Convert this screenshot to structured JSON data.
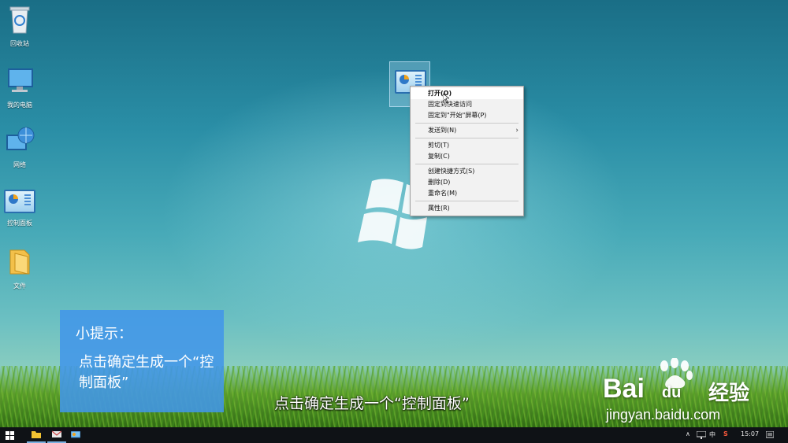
{
  "desktop": {
    "icons": [
      {
        "label": "回收站",
        "icon": "recycle-bin-icon"
      },
      {
        "label": "我的电脑",
        "icon": "computer-icon"
      },
      {
        "label": "网络",
        "icon": "network-icon"
      },
      {
        "label": "控制面板",
        "icon": "control-panel-icon"
      },
      {
        "label": "文件",
        "icon": "folder-icon"
      }
    ]
  },
  "context_menu": {
    "items": [
      {
        "label": "打开(O)",
        "highlight": true
      },
      {
        "label": "固定到快速访问"
      },
      {
        "label": "固定到\"开始\"屏幕(P)"
      },
      {
        "label": "发送到(N)",
        "submenu": true
      },
      {
        "label": "剪切(T)"
      },
      {
        "label": "复制(C)"
      },
      {
        "label": "创建快捷方式(S)"
      },
      {
        "label": "删除(D)"
      },
      {
        "label": "重命名(M)"
      },
      {
        "label": "属性(R)"
      }
    ],
    "submenu_arrow": "›"
  },
  "tip": {
    "title": "小提示：",
    "body": "点击确定生成一个“控制面板”"
  },
  "subtitle": "点击确定生成一个“控制面板”",
  "watermark": {
    "brand": "Bai",
    "brand_suffix": "du",
    "product": "经验",
    "url": "jingyan.baidu.com"
  },
  "taskbar": {
    "apps": [
      "start-icon",
      "file-explorer-icon",
      "mail-icon",
      "control-panel-icon"
    ],
    "ime": "中",
    "time": "15:07"
  },
  "colors": {
    "tip_bg": "#4296e8",
    "taskbar_bg": "#0f1216",
    "menu_bg": "#f2f2f2"
  }
}
